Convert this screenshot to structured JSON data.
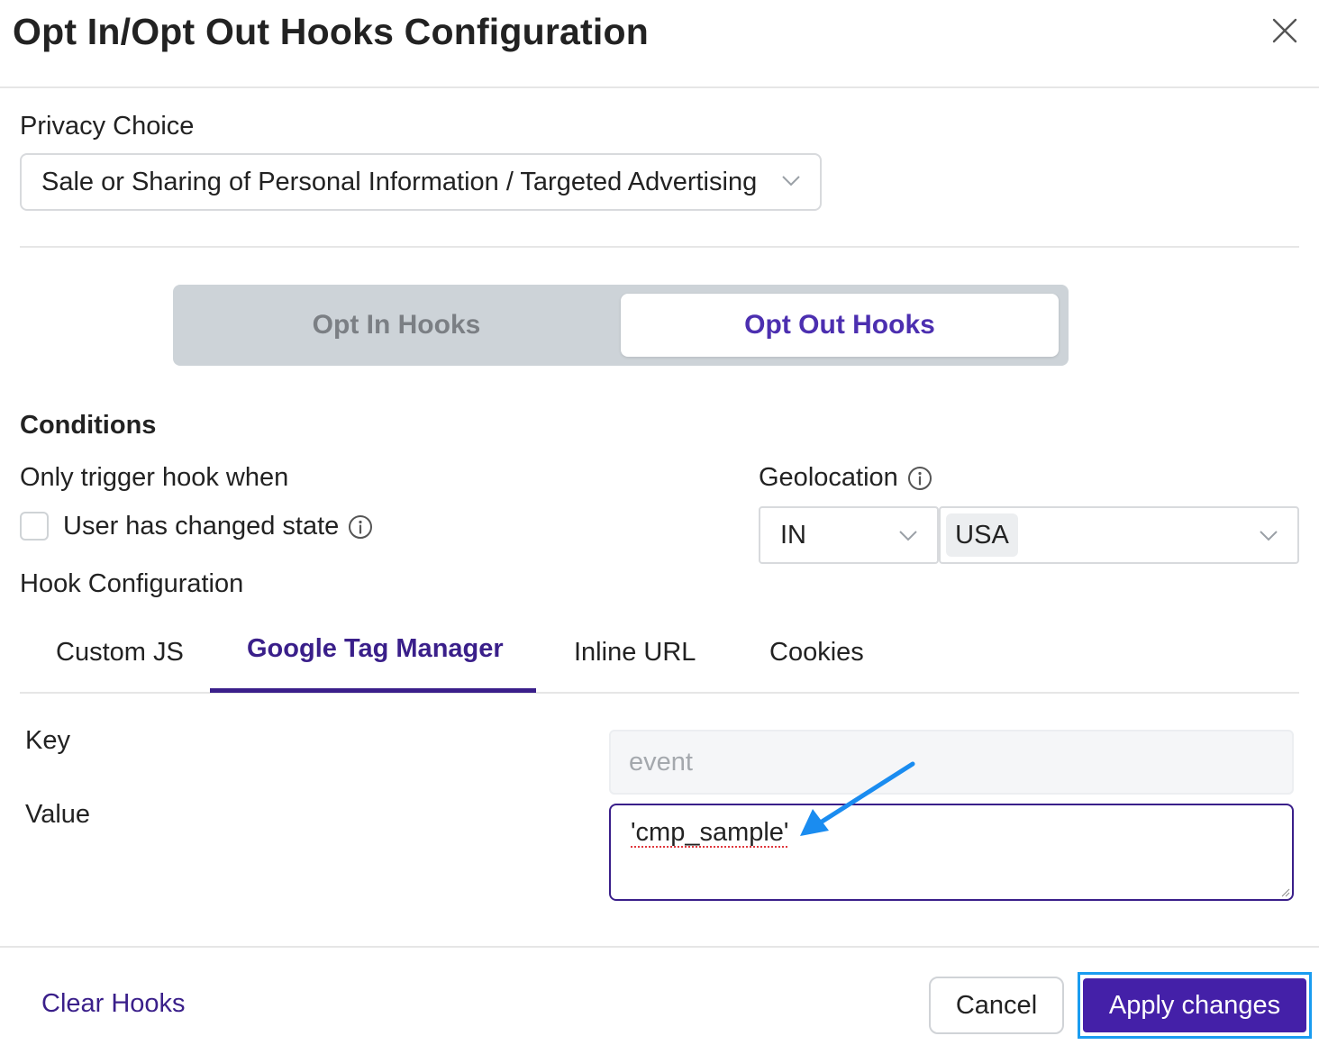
{
  "dialog": {
    "title": "Opt In/Opt Out Hooks Configuration"
  },
  "privacy_choice": {
    "label": "Privacy Choice",
    "selected": "Sale or Sharing of Personal Information / Targeted Advertising"
  },
  "hook_toggle": {
    "options": [
      "Opt In Hooks",
      "Opt Out Hooks"
    ],
    "active": "Opt Out Hooks"
  },
  "conditions": {
    "heading": "Conditions",
    "trigger_label": "Only trigger hook when",
    "checkbox_label": "User has changed state",
    "checkbox_checked": false
  },
  "geolocation": {
    "label": "Geolocation",
    "operator": "IN",
    "region": "USA"
  },
  "hook_configuration": {
    "label": "Hook Configuration",
    "tabs": [
      "Custom JS",
      "Google Tag Manager",
      "Inline URL",
      "Cookies"
    ],
    "active_tab": "Google Tag Manager"
  },
  "gtm": {
    "key_label": "Key",
    "key_placeholder": "event",
    "value_label": "Value",
    "value": "'cmp_sample'"
  },
  "footer": {
    "clear_label": "Clear Hooks",
    "cancel_label": "Cancel",
    "apply_label": "Apply changes"
  },
  "colors": {
    "accent": "#4420a8",
    "annotation_arrow": "#1a8cf0",
    "highlight_border": "#1a9cf0"
  }
}
